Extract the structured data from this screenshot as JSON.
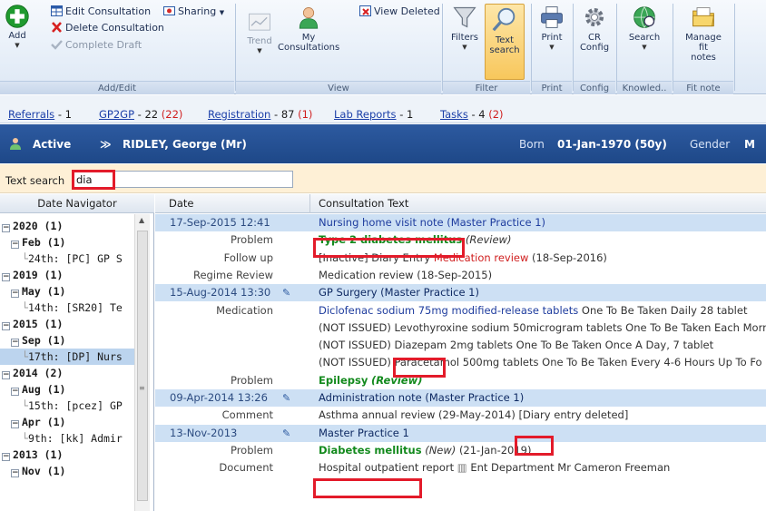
{
  "ribbon": {
    "add_label": "Add",
    "edit_consultation": "Edit Consultation",
    "delete_consultation": "Delete Consultation",
    "complete_draft": "Complete Draft",
    "sharing": "Sharing",
    "group_addedit": "Add/Edit",
    "trend": "Trend",
    "my_consultations": "My Consultations",
    "view_deleted": "View Deleted",
    "group_view": "View",
    "filters": "Filters",
    "text_search": "Text search",
    "group_filter": "Filter",
    "print": "Print",
    "group_print": "Print",
    "cr_config": "CR Config",
    "group_config": "Config",
    "search": "Search",
    "group_knowled": "Knowled..",
    "manage_fit_notes": "Manage fit notes",
    "group_fitnote": "Fit note"
  },
  "links": {
    "referrals": "Referrals",
    "referrals_count": "- 1",
    "gp2gp": "GP2GP",
    "gp2gp_count": "- 22",
    "gp2gp_red": "(22)",
    "registration": "Registration",
    "registration_count": "- 87",
    "registration_red": "(1)",
    "lab_reports": "Lab Reports",
    "lab_reports_count": "- 1",
    "tasks": "Tasks",
    "tasks_count": "- 4",
    "tasks_red": "(2)"
  },
  "banner": {
    "status": "Active",
    "patient_name": "RIDLEY, George (Mr)",
    "born_label": "Born",
    "born_value": "01-Jan-1970 (50y)",
    "gender_label": "Gender",
    "gender_value": "M"
  },
  "search": {
    "label": "Text search",
    "value": "dia"
  },
  "navigator": {
    "header": "Date Navigator",
    "items": [
      {
        "label": "2020 (1)",
        "level": 0,
        "glyph": "−"
      },
      {
        "label": "Feb (1)",
        "level": 1,
        "glyph": "−"
      },
      {
        "label": "24th: [PC] GP S",
        "level": 2
      },
      {
        "label": "2019 (1)",
        "level": 0,
        "glyph": "−"
      },
      {
        "label": "May (1)",
        "level": 1,
        "glyph": "−"
      },
      {
        "label": "14th: [SR20] Te",
        "level": 2
      },
      {
        "label": "2015 (1)",
        "level": 0,
        "glyph": "−"
      },
      {
        "label": "Sep (1)",
        "level": 1,
        "glyph": "−"
      },
      {
        "label": "17th: [DP] Nurs",
        "level": 2,
        "selected": true
      },
      {
        "label": "2014 (2)",
        "level": 0,
        "glyph": "−"
      },
      {
        "label": "Aug (1)",
        "level": 1,
        "glyph": "−"
      },
      {
        "label": "15th: [pcez] GP",
        "level": 2
      },
      {
        "label": "Apr (1)",
        "level": 1,
        "glyph": "−"
      },
      {
        "label": "9th: [kk] Admir",
        "level": 2
      },
      {
        "label": "2013 (1)",
        "level": 0,
        "glyph": "−"
      },
      {
        "label": "Nov (1)",
        "level": 1,
        "glyph": "−"
      }
    ]
  },
  "grid": {
    "col_date": "Date",
    "col_text": "Consultation Text",
    "rows": [
      {
        "type": "hdr",
        "c1": "17-Sep-2015 12:41",
        "c2": "Nursing home visit note (Master Practice 1)"
      },
      {
        "type": "item",
        "c1": "Problem",
        "c2a": "Type 2 diabetes mellitus",
        "c2b": "(Review)"
      },
      {
        "type": "item",
        "c1": "Follow up",
        "c2a": "[Inactive] Diary Entry",
        "c2b": "Medication review",
        "c2c": "(18-Sep-2016)"
      },
      {
        "type": "item",
        "c1": "Regime Review",
        "c2a": "Medication review  (18-Sep-2015)"
      },
      {
        "type": "hdr",
        "c1": "15-Aug-2014 13:30",
        "c2": "GP Surgery (Master Practice 1)"
      },
      {
        "type": "item",
        "c1": "Medication",
        "c2a": "Diclofenac sodium 75mg modified-release tablets",
        "c2b": "One To Be Taken Daily  28 tablet"
      },
      {
        "type": "item",
        "c1": "",
        "c2a": "(NOT ISSUED) Levothyroxine sodium 50microgram tablets One To Be Taken Each Morn"
      },
      {
        "type": "item",
        "c1": "",
        "c2a": "(NOT ISSUED)",
        "c2b": "Diazepam",
        "c2c": "2mg tablets One To Be Taken Once A Day, 7 tablet"
      },
      {
        "type": "item",
        "c1": "",
        "c2a": "(NOT ISSUED) Paracetamol 500mg tablets One To Be Taken Every 4-6 Hours Up To Fo"
      },
      {
        "type": "item",
        "c1": "Problem",
        "c2a": "Epilepsy",
        "c2b": "(Review)"
      },
      {
        "type": "hdr",
        "c1": "09-Apr-2014 13:26",
        "c2": "Administration note (Master Practice 1)"
      },
      {
        "type": "item",
        "c1": "Comment",
        "c2a": "Asthma annual review  (29-May-2014)",
        "c2b": "[Diary",
        "c2c": "entry deleted]"
      },
      {
        "type": "hdr",
        "c1": "13-Nov-2013",
        "c2": "Master Practice 1"
      },
      {
        "type": "item",
        "c1": "Problem",
        "c2a": "Diabetes mellitus",
        "c2b": "(New)",
        "c2c": "(21-Jan-2019)"
      },
      {
        "type": "item",
        "c1": "Document",
        "c2a": "Hospital outpatient report",
        "c2b": "Ent Department Mr Cameron Freeman"
      }
    ]
  }
}
